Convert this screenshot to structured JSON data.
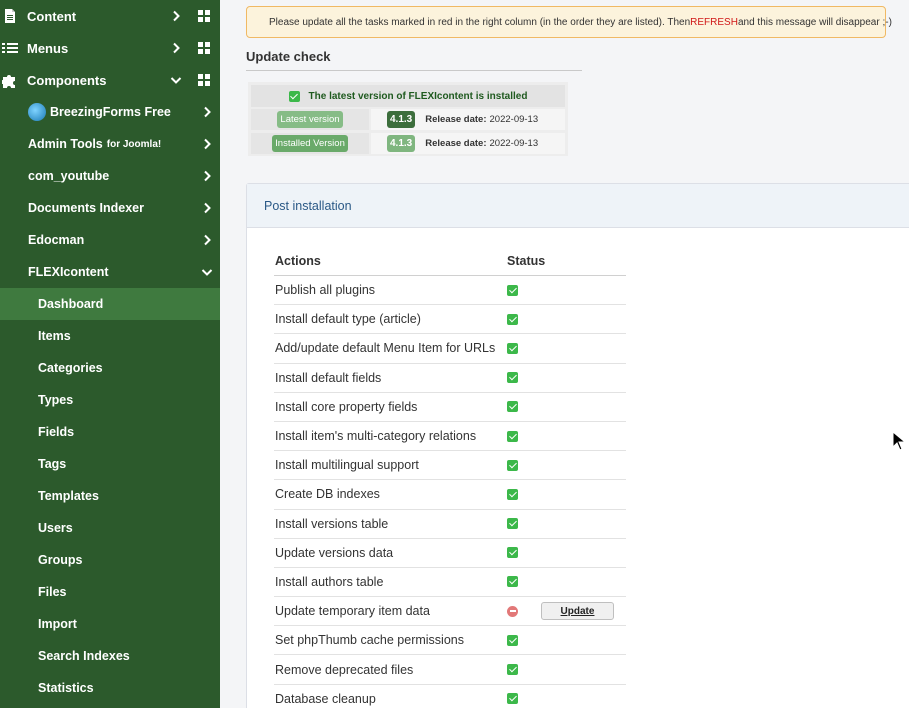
{
  "sidebar": {
    "top": [
      {
        "label": "Content",
        "icon": "file-icon"
      },
      {
        "label": "Menus",
        "icon": "list-icon"
      },
      {
        "label": "Components",
        "icon": "puzzle-icon"
      }
    ],
    "components": [
      {
        "label": "BreezingForms Free",
        "suffix": ""
      },
      {
        "label": "Admin Tools",
        "suffix": "for Joomla!"
      },
      {
        "label": "com_youtube",
        "suffix": ""
      },
      {
        "label": "Documents Indexer",
        "suffix": ""
      },
      {
        "label": "Edocman",
        "suffix": ""
      },
      {
        "label": "FLEXIcontent",
        "suffix": ""
      }
    ],
    "flexicontent": [
      "Dashboard",
      "Items",
      "Categories",
      "Types",
      "Fields",
      "Tags",
      "Templates",
      "Users",
      "Groups",
      "Files",
      "Import",
      "Search Indexes",
      "Statistics"
    ],
    "active": "Dashboard"
  },
  "alert": {
    "text_before": "Please update all the tasks marked in red in the right column (in the order they are listed). Then ",
    "refresh": "REFRESH",
    "text_after": " and this message will disappear ;-)"
  },
  "update_check": {
    "title": "Update check",
    "status": "The latest version of FLEXIcontent is installed",
    "latest": {
      "label": "Latest version",
      "version": "4.1.3",
      "release_label": "Release date:",
      "date": "2022-09-13"
    },
    "installed": {
      "label": "Installed Version",
      "version": "4.1.3",
      "release_label": "Release date:",
      "date": "2022-09-13"
    }
  },
  "post_install": {
    "title": "Post installation",
    "col_actions": "Actions",
    "col_status": "Status",
    "update_label": "Update",
    "rows": [
      {
        "action": "Publish all plugins",
        "status": "ok"
      },
      {
        "action": "Install default type (article)",
        "status": "ok"
      },
      {
        "action": "Add/update default Menu Item for URLs",
        "status": "ok"
      },
      {
        "action": "Install default fields",
        "status": "ok"
      },
      {
        "action": "Install core property fields",
        "status": "ok"
      },
      {
        "action": "Install item's multi-category relations",
        "status": "ok"
      },
      {
        "action": "Install multilingual support",
        "status": "ok"
      },
      {
        "action": "Create DB indexes",
        "status": "ok"
      },
      {
        "action": "Install versions table",
        "status": "ok"
      },
      {
        "action": "Update versions data",
        "status": "ok"
      },
      {
        "action": "Install authors table",
        "status": "ok"
      },
      {
        "action": "Update temporary item data",
        "status": "pending"
      },
      {
        "action": "Set phpThumb cache permissions",
        "status": "ok"
      },
      {
        "action": "Remove deprecated files",
        "status": "ok"
      },
      {
        "action": "Database cleanup",
        "status": "ok"
      }
    ]
  },
  "colors": {
    "sidebar_bg": "#2c5a2c",
    "sidebar_active": "#3f7a3f",
    "ok_green": "#3cb84a",
    "pending_red": "#e27878",
    "refresh_red": "#d01818"
  }
}
